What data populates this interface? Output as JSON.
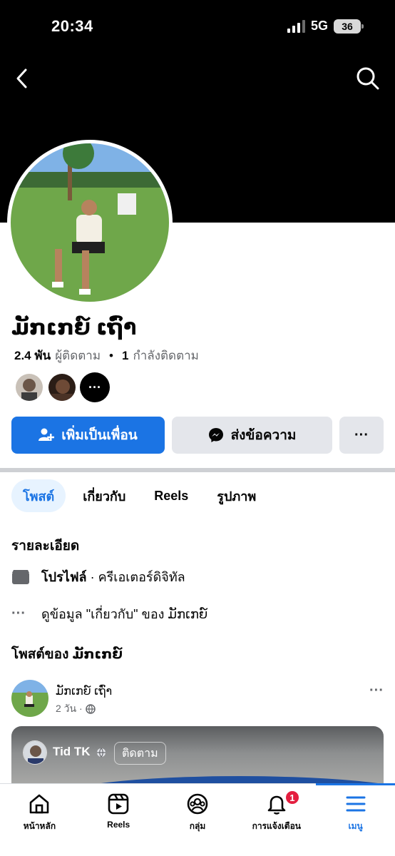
{
  "status_bar": {
    "time": "20:34",
    "network": "5G",
    "battery": "36"
  },
  "profile": {
    "name": "ມັກເກຍ໌ ເຖົ່າ",
    "followers_count": "2.4 พัน",
    "followers_label": "ผู้ติดตาม",
    "separator": "•",
    "following_count": "1",
    "following_label": "กำลังติดตาม"
  },
  "actions": {
    "add_friend": "เพิ่มเป็นเพื่อน",
    "message": "ส่งข้อความ",
    "more": "···"
  },
  "tabs": [
    {
      "label": "โพสต์",
      "active": true
    },
    {
      "label": "เกี่ยวกับ"
    },
    {
      "label": "Reels"
    },
    {
      "label": "รูปภาพ"
    }
  ],
  "details": {
    "title": "รายละเอียด",
    "profile_type_label": "โปรไฟล์",
    "profile_type_value": " · ครีเอเตอร์ดิจิทัล",
    "about_link": "ดูข้อมูล \"เกี่ยวกับ\" ของ ມັກເກຍ໌"
  },
  "posts": {
    "title": "โพสต์ของ ມັກເກຍ໌",
    "first": {
      "author": "ມັກເກຍ໌ ເຖົ່າ",
      "time": "2 วัน ·"
    },
    "shared": {
      "name": "Tid TK",
      "follow_label": "ติดตาม"
    }
  },
  "bottom_nav": [
    {
      "label": "หน้าหลัก",
      "icon": "home-icon"
    },
    {
      "label": "Reels",
      "icon": "reels-icon"
    },
    {
      "label": "กลุ่ม",
      "icon": "groups-icon"
    },
    {
      "label": "การแจ้งเตือน",
      "icon": "bell-icon",
      "badge": "1"
    },
    {
      "label": "เมนู",
      "icon": "menu-icon",
      "active": true
    }
  ],
  "colors": {
    "accent": "#1b74e4",
    "badge": "#e41e3f"
  }
}
